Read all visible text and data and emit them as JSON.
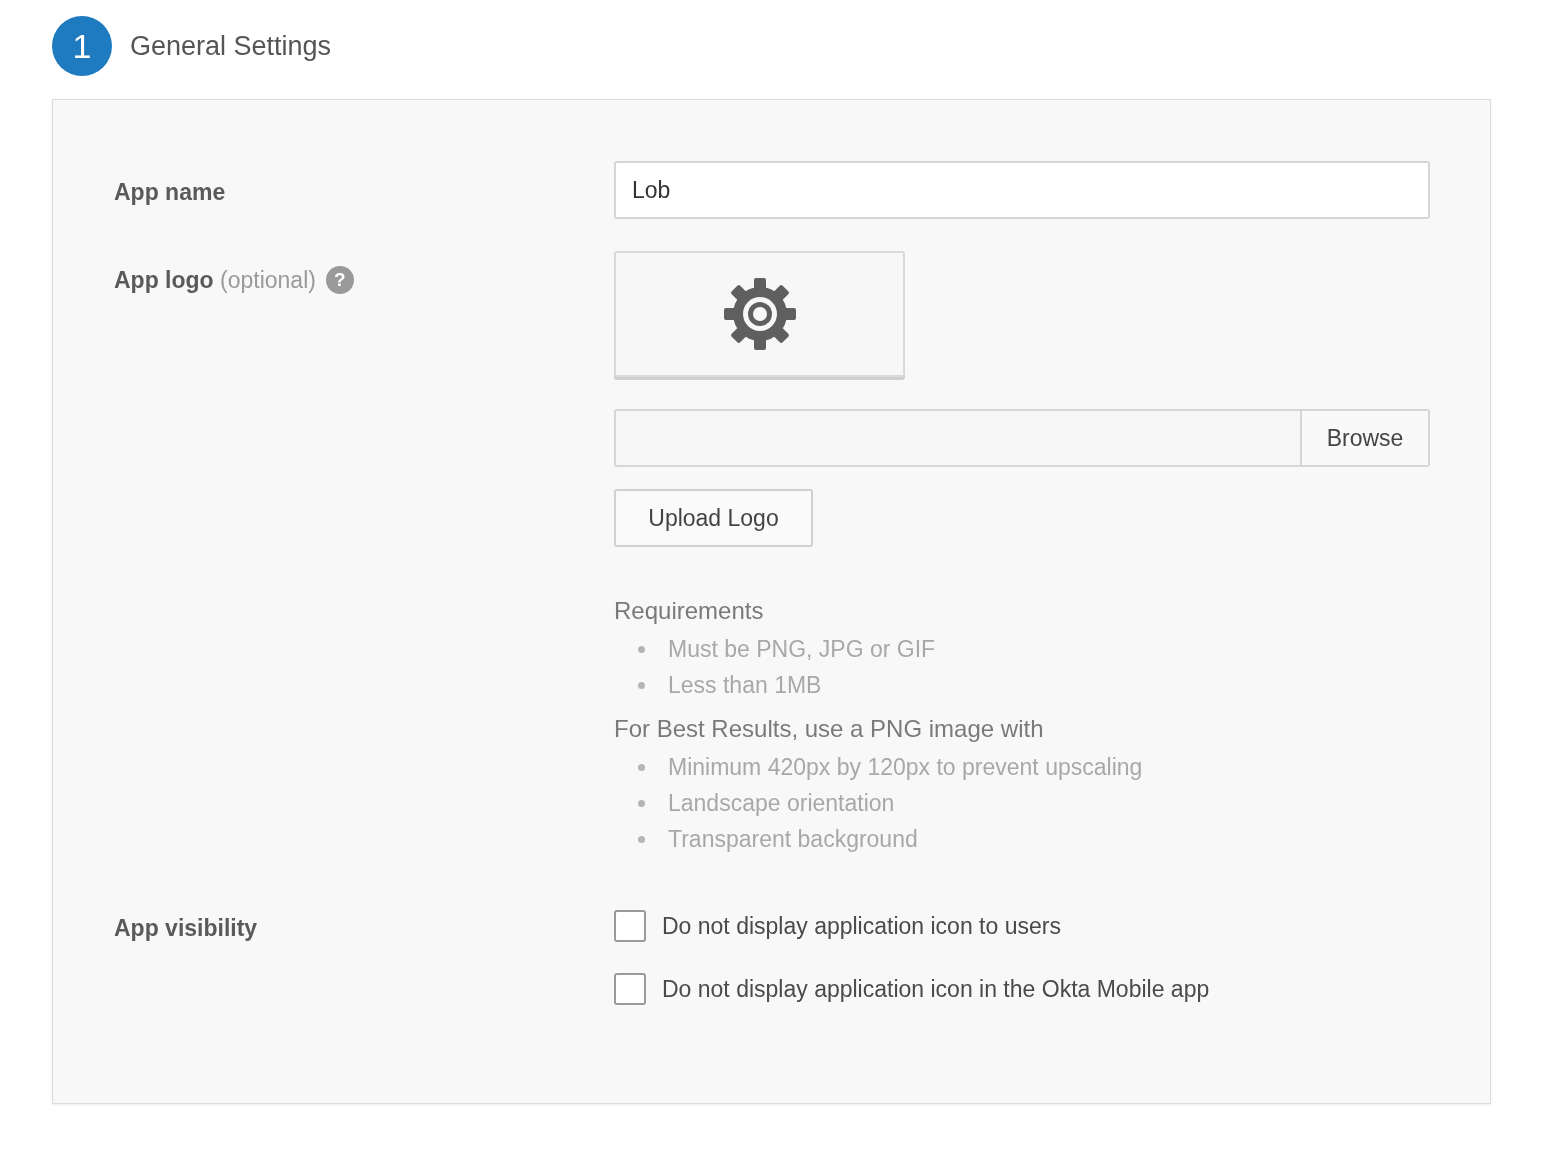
{
  "step": {
    "number": "1",
    "title": "General Settings"
  },
  "app_name": {
    "label": "App name",
    "value": "Lob"
  },
  "app_logo": {
    "label": "App logo",
    "optional": "(optional)",
    "help": "?",
    "browse_button": "Browse",
    "upload_button": "Upload Logo",
    "requirements": {
      "heading": "Requirements",
      "items": [
        "Must be PNG, JPG or GIF",
        "Less than 1MB"
      ]
    },
    "best_results": {
      "heading": "For Best Results, use a PNG image with",
      "items": [
        "Minimum 420px by 120px to prevent upscaling",
        "Landscape orientation",
        "Transparent background"
      ]
    }
  },
  "app_visibility": {
    "label": "App visibility",
    "options": [
      {
        "label": "Do not display application icon to users",
        "checked": false
      },
      {
        "label": "Do not display application icon in the Okta Mobile app",
        "checked": false
      }
    ]
  }
}
